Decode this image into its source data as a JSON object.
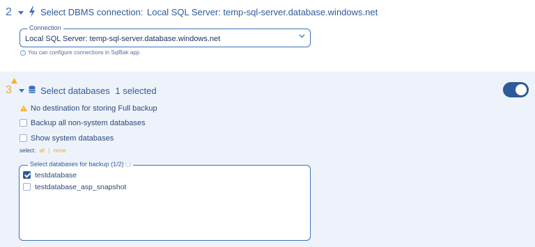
{
  "step2": {
    "number": "2",
    "title": "Select DBMS connection:",
    "value": "Local SQL Server: temp-sql-server.database.windows.net",
    "connection_legend": "Connection",
    "connection_value": "Local SQL Server: temp-sql-server.database.windows.net",
    "info_text": "You can configure connections in SqlBak app"
  },
  "step3": {
    "number": "3",
    "title": "Select databases",
    "count": "1 selected",
    "toggle_on": true,
    "warning": "No destination for storing Full backup",
    "options": [
      {
        "label": "Backup all non-system databases",
        "checked": false
      },
      {
        "label": "Show system databases",
        "checked": false
      }
    ],
    "select_label": "select:",
    "select_all": "all",
    "select_sep": "|",
    "select_none": "none",
    "databases_legend": "Select databases for backup (1/2)",
    "databases": [
      {
        "name": "testdatabase",
        "checked": true
      },
      {
        "name": "testdatabase_asp_snapshot",
        "checked": false
      }
    ]
  },
  "colors": {
    "accent": "#2f5a9a",
    "warning": "#e8a73a",
    "panel_bg": "#eef3fb"
  }
}
